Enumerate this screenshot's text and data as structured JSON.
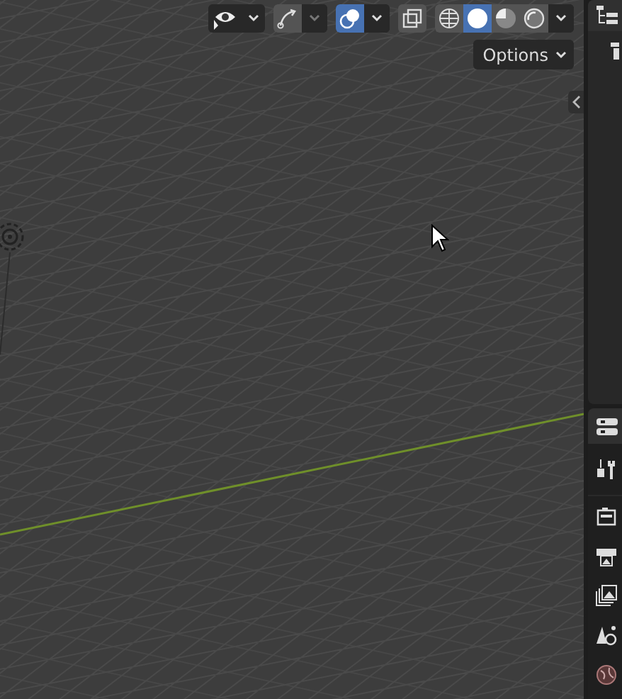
{
  "viewport_header": {
    "overlays": {
      "on": true
    },
    "gizmos": {
      "on": false
    },
    "xray": {
      "on": false
    },
    "shading_modes": [
      {
        "kind": "wireframe",
        "selected": false
      },
      {
        "kind": "solid",
        "selected": true
      },
      {
        "kind": "material",
        "selected": false
      },
      {
        "kind": "rendered",
        "selected": false
      }
    ]
  },
  "options_button": {
    "label": "Options"
  },
  "properties_tabs": [
    {
      "kind": "tool",
      "selected": false
    },
    {
      "kind": "render",
      "selected": false
    },
    {
      "kind": "output",
      "selected": false
    },
    {
      "kind": "view_layer",
      "selected": false
    },
    {
      "kind": "scene",
      "selected": false
    },
    {
      "kind": "world",
      "selected": false
    }
  ]
}
